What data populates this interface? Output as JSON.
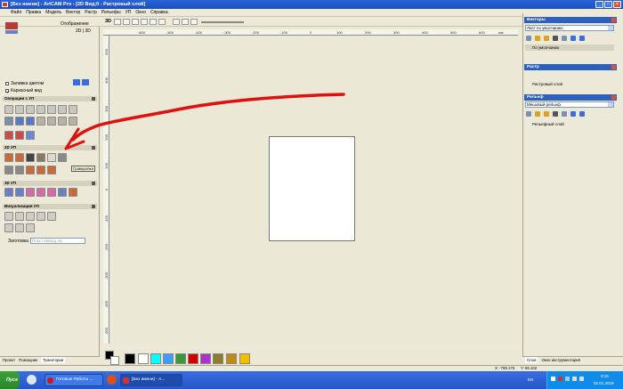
{
  "window": {
    "title": "[Без имени] - ArtCAM Pro - [2D Вид;0 - Растровый слой]"
  },
  "menu": [
    "Файл",
    "Правка",
    "Модель",
    "Вектор",
    "Растр",
    "Рельефы",
    "УП",
    "Окно",
    "Справка"
  ],
  "view_label": "3D",
  "left_panel": {
    "header_title": "Отображение",
    "header_sub": "2D | 3D",
    "fill_color_label": "Заливка цветом",
    "wireframe_label": "Каркасный вид",
    "sections": [
      "Операции с УП",
      "2D УП",
      "3D УП",
      "Визуализация УП"
    ],
    "tooltip": "Гравировка",
    "workpiece_label": "Заготовка",
    "workpiece_placeholder": "Пласт имп/пд, 5х",
    "tabs": [
      "Проект",
      "Помощник",
      "Траектории"
    ]
  },
  "ruler_h": [
    "-600",
    "-500",
    "-400",
    "-300",
    "-200",
    "-100",
    "0",
    "100",
    "200",
    "300",
    "400",
    "500",
    "600",
    "мм"
  ],
  "ruler_v": [
    "500",
    "400",
    "300",
    "200",
    "100",
    "0",
    "-100",
    "-200",
    "-300",
    "-400",
    "-500"
  ],
  "palette": {
    "colors": [
      "#000000",
      "#ffffff",
      "#00ffff",
      "#3c9cff",
      "#3c963c",
      "#d40000",
      "#aa33cc",
      "#8b7d2e",
      "#c08a18",
      "#f0c000"
    ]
  },
  "right_panel": {
    "vectors": {
      "title": "Векторы",
      "layer_select": "Лист по умолчанию",
      "item": "По умолчанию"
    },
    "raster": {
      "title": "Растр",
      "item": "Растровый слой"
    },
    "relief": {
      "title": "Рельеф",
      "layer_select": "Мешовый рельеф",
      "item": "Рельефный слой"
    },
    "tabs": [
      "Слои",
      "Окно инструментария"
    ]
  },
  "statusbar": {
    "coords": "X: -785.175",
    "coords_y": "Y: 69.102"
  },
  "taskbar": {
    "start": "Пуск",
    "tasks": [
      "Готовые Работы ...",
      "[Без имени] - A..."
    ],
    "lang": "EN",
    "time": "9:15",
    "date": "02.01.2019"
  }
}
